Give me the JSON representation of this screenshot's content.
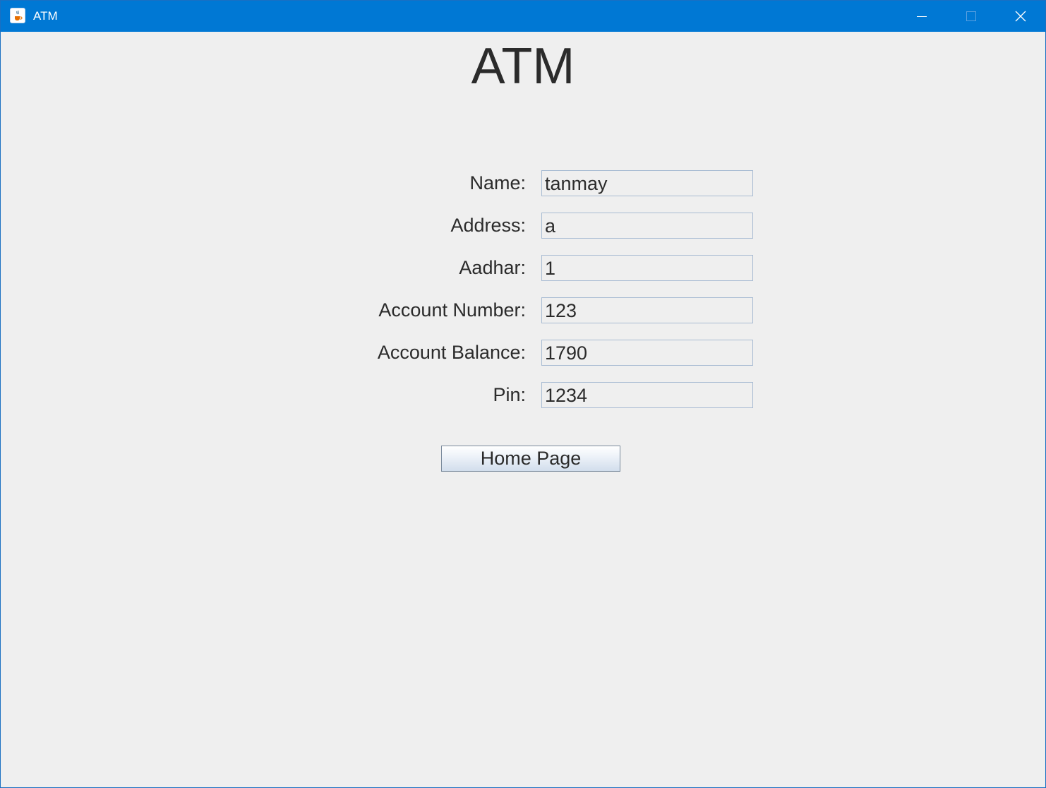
{
  "window": {
    "title": "ATM",
    "icon": "java-cup-icon",
    "controls": [
      "minimize-icon",
      "maximize-icon",
      "close-icon"
    ],
    "accent_color": "#0078d4",
    "background_color": "#efefef"
  },
  "main": {
    "heading": "ATM",
    "fields": [
      {
        "label": "Name:",
        "value": "tanmay"
      },
      {
        "label": "Address:",
        "value": "a"
      },
      {
        "label": "Aadhar:",
        "value": "1"
      },
      {
        "label": "Account Number:",
        "value": "123"
      },
      {
        "label": "Account Balance:",
        "value": "1790"
      },
      {
        "label": "Pin:",
        "value": "1234"
      }
    ],
    "home_button_label": "Home Page"
  }
}
